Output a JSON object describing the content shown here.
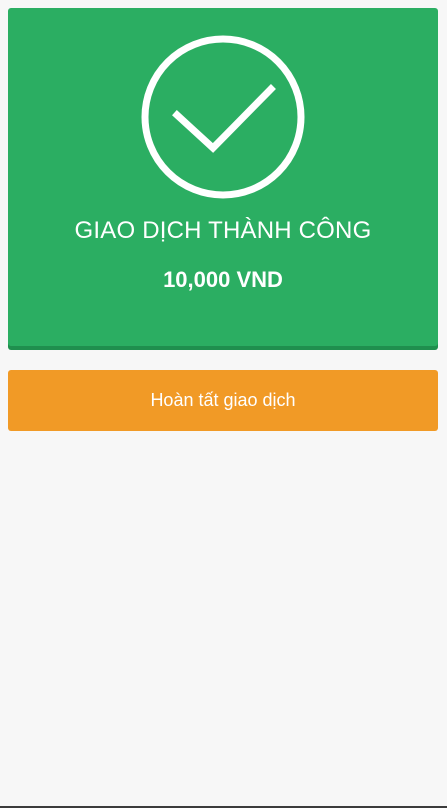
{
  "status": {
    "title": "GIAO DỊCH THÀNH CÔNG",
    "amount": "10,000 VND",
    "icon": "check-circle-icon",
    "color": "#2bae62"
  },
  "actions": {
    "finish_label": "Hoàn tất giao dịch",
    "finish_color": "#f19a26"
  }
}
